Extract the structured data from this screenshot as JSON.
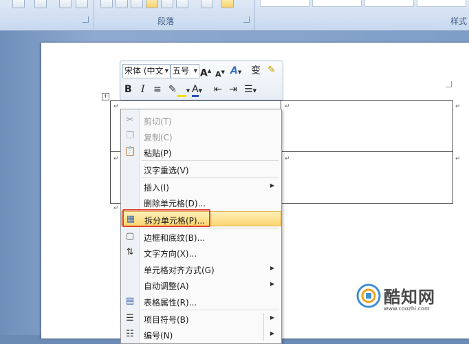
{
  "ribbon": {
    "groups": [
      {
        "label": "段落"
      },
      {
        "label": "样式"
      }
    ]
  },
  "mini_toolbar": {
    "font_name": "宋体 (中文",
    "font_size": "五号",
    "grow_font": "A",
    "shrink_font": "A",
    "styles": "A",
    "phonetic": "变",
    "bold": "B",
    "italic": "I",
    "font_color": "A"
  },
  "context_menu": {
    "items": [
      {
        "label": "剪切(T)",
        "icon": "scissors-icon",
        "enabled": false
      },
      {
        "label": "复制(C)",
        "icon": "copy-icon",
        "enabled": false
      },
      {
        "label": "粘贴(P)",
        "icon": "paste-icon",
        "enabled": true
      },
      {
        "label": "汉字重选(V)",
        "enabled": true
      },
      {
        "label": "插入(I)",
        "enabled": true,
        "submenu": true
      },
      {
        "label": "删除单元格(D)...",
        "enabled": true
      },
      {
        "label": "拆分单元格(P)...",
        "icon": "split-cells-icon",
        "enabled": true,
        "highlighted": true
      },
      {
        "label": "边框和底纹(B)...",
        "icon": "borders-icon",
        "enabled": true
      },
      {
        "label": "文字方向(X)...",
        "icon": "text-direction-icon",
        "enabled": true
      },
      {
        "label": "单元格对齐方式(G)",
        "enabled": true,
        "submenu": true
      },
      {
        "label": "自动调整(A)",
        "enabled": true,
        "submenu": true
      },
      {
        "label": "表格属性(R)...",
        "icon": "table-properties-icon",
        "enabled": true
      },
      {
        "label": "项目符号(B)",
        "icon": "bullets-icon",
        "enabled": true,
        "submenu": true
      },
      {
        "label": "编号(N)",
        "icon": "numbering-icon",
        "enabled": true,
        "submenu": true
      }
    ]
  },
  "watermark": {
    "name": "酷知网",
    "url": "www.coozhi.com"
  },
  "colors": {
    "highlight": "#fbd56f",
    "callout": "#e0412f",
    "ribbon": "#c7d8ee"
  }
}
